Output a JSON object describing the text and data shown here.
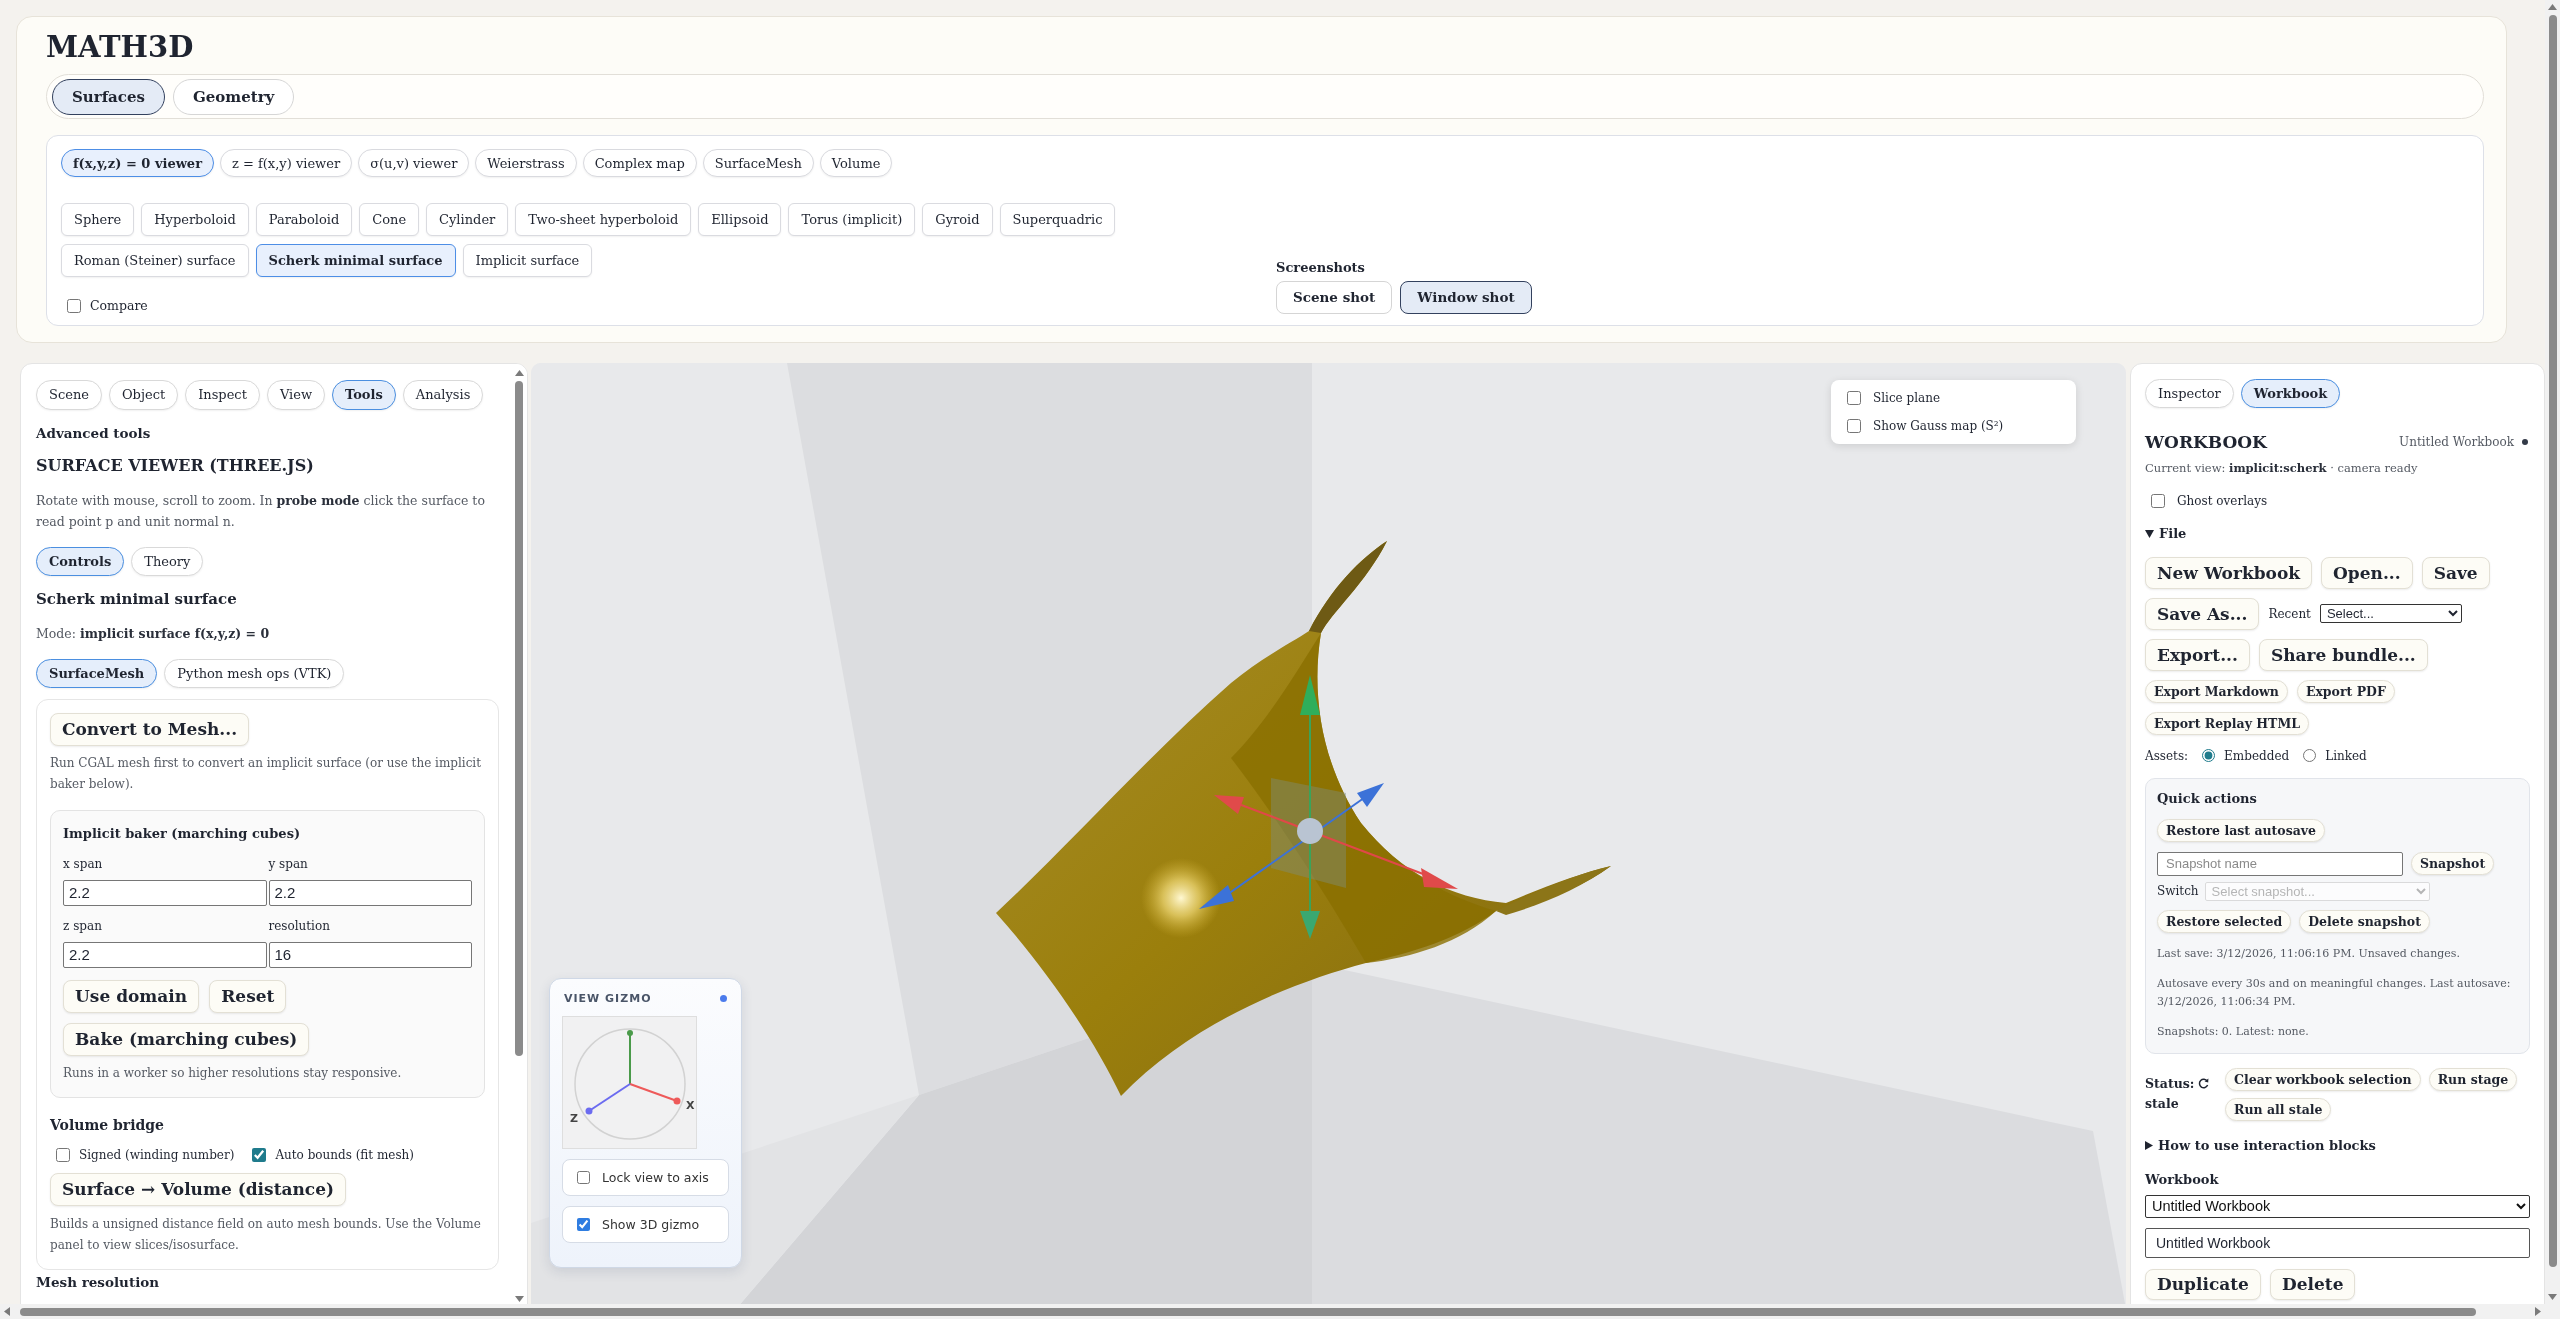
{
  "app": {
    "title": "MATH3D"
  },
  "top_tabs": [
    {
      "label": "Surfaces",
      "selected": true
    },
    {
      "label": "Geometry",
      "selected": false
    }
  ],
  "viewer_modes": [
    {
      "label": "f(x,y,z) = 0 viewer",
      "selected": true
    },
    {
      "label": "z = f(x,y) viewer",
      "selected": false
    },
    {
      "label": "σ(u,v) viewer",
      "selected": false
    },
    {
      "label": "Weierstrass",
      "selected": false
    },
    {
      "label": "Complex map",
      "selected": false
    },
    {
      "label": "SurfaceMesh",
      "selected": false
    },
    {
      "label": "Volume",
      "selected": false
    }
  ],
  "presets": [
    {
      "label": "Sphere",
      "selected": false
    },
    {
      "label": "Hyperboloid",
      "selected": false
    },
    {
      "label": "Paraboloid",
      "selected": false
    },
    {
      "label": "Cone",
      "selected": false
    },
    {
      "label": "Cylinder",
      "selected": false
    },
    {
      "label": "Two-sheet hyperboloid",
      "selected": false
    },
    {
      "label": "Ellipsoid",
      "selected": false
    },
    {
      "label": "Torus (implicit)",
      "selected": false
    },
    {
      "label": "Gyroid",
      "selected": false
    },
    {
      "label": "Superquadric",
      "selected": false
    },
    {
      "label": "Roman (Steiner) surface",
      "selected": false
    },
    {
      "label": "Scherk minimal surface",
      "selected": true
    },
    {
      "label": "Implicit surface",
      "selected": false
    }
  ],
  "compare": {
    "label": "Compare",
    "checked": false
  },
  "screenshots": {
    "title": "Screenshots",
    "buttons": [
      {
        "label": "Scene shot",
        "selected": false
      },
      {
        "label": "Window shot",
        "selected": true
      }
    ]
  },
  "left_panel": {
    "tabs": [
      {
        "label": "Scene",
        "selected": false
      },
      {
        "label": "Object",
        "selected": false
      },
      {
        "label": "Inspect",
        "selected": false
      },
      {
        "label": "View",
        "selected": false
      },
      {
        "label": "Tools",
        "selected": true
      },
      {
        "label": "Analysis",
        "selected": false
      }
    ],
    "section_label": "Advanced tools",
    "heading": "SURFACE VIEWER (THREE.JS)",
    "description": "Rotate with mouse, scroll to zoom. In **probe mode** click the surface to read point p and unit normal n.",
    "subtabs": [
      {
        "label": "Controls",
        "selected": true
      },
      {
        "label": "Theory",
        "selected": false
      }
    ],
    "surface_name": "Scherk minimal surface",
    "mode": "Mode: **implicit surface f(x,y,z) = 0**",
    "mesh_tabs": [
      {
        "label": "SurfaceMesh",
        "selected": true
      },
      {
        "label": "Python mesh ops (VTK)",
        "selected": false
      }
    ],
    "mesh_card": {
      "convert_button": "Convert to Mesh...",
      "convert_note": "Run CGAL mesh first to convert an implicit surface (or use the implicit baker below).",
      "baker": {
        "title": "Implicit baker (marching cubes)",
        "fields": [
          {
            "label": "x span",
            "value": "2.2"
          },
          {
            "label": "y span",
            "value": "2.2"
          },
          {
            "label": "z span",
            "value": "2.2"
          },
          {
            "label": "resolution",
            "value": "16"
          }
        ],
        "buttons": [
          "Use domain",
          "Reset"
        ],
        "bake_button": "Bake (marching cubes)",
        "note": "Runs in a worker so higher resolutions stay responsive."
      },
      "volume_bridge": {
        "title": "Volume bridge",
        "options": [
          {
            "label": "Signed (winding number)",
            "checked": false
          },
          {
            "label": "Auto bounds (fit mesh)",
            "checked": true
          }
        ],
        "button": "Surface → Volume (distance)",
        "note": "Builds a unsigned distance field on auto mesh bounds. Use the Volume panel to view slices/isosurface."
      }
    },
    "next_section": "Mesh resolution"
  },
  "viewport": {
    "overlay_options": [
      {
        "label": "Slice plane",
        "checked": false
      },
      {
        "label": "Show Gauss map (S²)",
        "checked": false
      }
    ],
    "gizmo_panel": {
      "title": "VIEW GIZMO",
      "axis_labels": [
        "X",
        "Z"
      ],
      "options": [
        {
          "label": "Lock view to axis",
          "checked": false
        },
        {
          "label": "Show 3D gizmo",
          "checked": true
        }
      ]
    }
  },
  "right_panel": {
    "tabs": [
      {
        "label": "Inspector",
        "selected": false
      },
      {
        "label": "Workbook",
        "selected": true
      }
    ],
    "title": "WORKBOOK",
    "workbook_name": "Untitled Workbook",
    "unsaved": true,
    "current_view": "Current view: **implicit:scherk** · camera ready",
    "ghost_overlays": {
      "label": "Ghost overlays",
      "checked": false
    },
    "file_section": {
      "label": "File",
      "expanded": true,
      "actions": [
        {
          "kind": "button",
          "label": "New Workbook"
        },
        {
          "kind": "button",
          "label": "Open..."
        },
        {
          "kind": "button",
          "label": "Save"
        },
        {
          "kind": "button",
          "label": "Save As..."
        },
        {
          "kind": "label",
          "label": "Recent"
        },
        {
          "kind": "select",
          "label": "Select..."
        },
        {
          "kind": "button",
          "label": "Export..."
        },
        {
          "kind": "button",
          "label": "Share bundle..."
        },
        {
          "kind": "small_button",
          "label": "Export Markdown"
        },
        {
          "kind": "small_button",
          "label": "Export PDF"
        },
        {
          "kind": "small_button",
          "label": "Export Replay HTML"
        }
      ],
      "assets": {
        "label": "Assets:",
        "options": [
          {
            "label": "Embedded",
            "selected": true
          },
          {
            "label": "Linked",
            "selected": false
          }
        ]
      }
    },
    "quick_actions": {
      "title": "Quick actions",
      "restore_button": "Restore last autosave",
      "snapshot_field": {
        "placeholder": "Snapshot name"
      },
      "snapshot_button": "Snapshot",
      "switch": {
        "label": "Switch",
        "placeholder": "Select snapshot...",
        "disabled": true
      },
      "buttons": [
        "Restore selected",
        "Delete snapshot"
      ],
      "notes": [
        "Last save: 3/12/2026, 11:06:16 PM. Unsaved changes.",
        "Autosave every 30s and on meaningful changes. Last autosave: 3/12/2026, 11:06:34 PM.",
        "Snapshots: 0. Latest: none."
      ]
    },
    "status": {
      "label": "Status:",
      "value": "stale",
      "buttons": [
        "Clear workbook selection",
        "Run stage",
        "Run all stale"
      ]
    },
    "help": {
      "label": "How to use interaction blocks",
      "expanded": false
    },
    "workbook": {
      "label": "Workbook",
      "select_value": "Untitled Workbook",
      "name_value": "Untitled Workbook",
      "buttons": [
        "Duplicate",
        "Delete"
      ]
    }
  }
}
